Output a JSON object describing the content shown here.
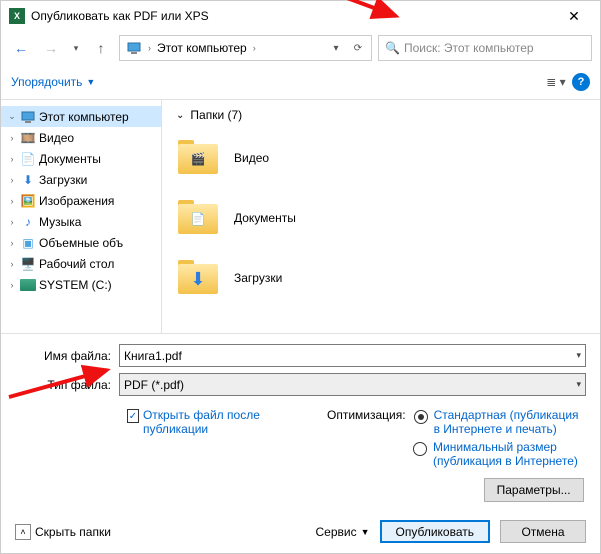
{
  "title": "Опубликовать как PDF или XPS",
  "breadcrumb": {
    "label": "Этот компьютер"
  },
  "search": {
    "placeholder": "Поиск: Этот компьютер"
  },
  "toolbar": {
    "organize": "Упорядочить"
  },
  "tree": {
    "root": "Этот компьютер",
    "items": [
      {
        "label": "Видео",
        "chev": "›"
      },
      {
        "label": "Документы",
        "chev": "›"
      },
      {
        "label": "Загрузки",
        "chev": "›"
      },
      {
        "label": "Изображения",
        "chev": "›"
      },
      {
        "label": "Музыка",
        "chev": "›"
      },
      {
        "label": "Объемные объ",
        "chev": "›"
      },
      {
        "label": "Рабочий стол",
        "chev": "›"
      },
      {
        "label": "SYSTEM (C:)",
        "chev": "›"
      }
    ]
  },
  "folders": {
    "header": "Папки (7)",
    "list": [
      {
        "label": "Видео"
      },
      {
        "label": "Документы"
      },
      {
        "label": "Загрузки"
      }
    ]
  },
  "fields": {
    "filename_label": "Имя файла:",
    "filename_value": "Книга1.pdf",
    "filetype_label": "Тип файла:",
    "filetype_value": "PDF (*.pdf)"
  },
  "options": {
    "open_after": "Открыть файл после публикации",
    "optimize_label": "Оптимизация:",
    "standard": "Стандартная (публикация в Интернете и печать)",
    "minimal": "Минимальный размер (публикация в Интернете)",
    "params": "Параметры..."
  },
  "footer": {
    "hide": "Скрыть папки",
    "tools": "Сервис",
    "publish": "Опубликовать",
    "cancel": "Отмена"
  }
}
